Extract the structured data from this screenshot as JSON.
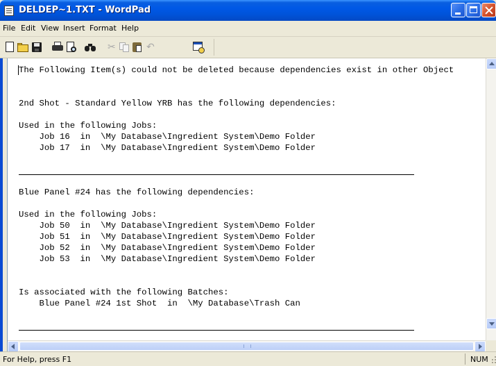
{
  "window": {
    "title": "DELDEP~1.TXT - WordPad",
    "controls": [
      "minimize",
      "maximize",
      "close"
    ]
  },
  "menubar": {
    "items": [
      {
        "label": "File"
      },
      {
        "label": "Edit"
      },
      {
        "label": "View"
      },
      {
        "label": "Insert"
      },
      {
        "label": "Format"
      },
      {
        "label": "Help"
      }
    ]
  },
  "toolbar": {
    "buttons": [
      {
        "name": "new",
        "icon": "new-document-icon",
        "enabled": true
      },
      {
        "name": "open",
        "icon": "open-folder-icon",
        "enabled": true
      },
      {
        "name": "save",
        "icon": "save-disk-icon",
        "enabled": true
      },
      {
        "name": "print",
        "icon": "printer-icon",
        "enabled": true
      },
      {
        "name": "print-preview",
        "icon": "print-preview-icon",
        "enabled": true
      },
      {
        "name": "find",
        "icon": "binoculars-icon",
        "enabled": true
      },
      {
        "name": "cut",
        "icon": "scissors-icon",
        "enabled": false
      },
      {
        "name": "copy",
        "icon": "copy-icon",
        "enabled": false
      },
      {
        "name": "paste",
        "icon": "paste-icon",
        "enabled": true
      },
      {
        "name": "undo",
        "icon": "undo-icon",
        "enabled": false
      },
      {
        "name": "date-time",
        "icon": "date-time-icon",
        "enabled": true
      }
    ]
  },
  "document": {
    "lines": [
      "The Following Item(s) could not be deleted because dependencies exist in other Object",
      "2nd Shot - Standard Yellow YRB has the following dependencies:",
      "Used in the following Jobs:",
      "    Job 16  in  \\My Database\\Ingredient System\\Demo Folder",
      "    Job 17  in  \\My Database\\Ingredient System\\Demo Folder",
      "Blue Panel #24 has the following dependencies:",
      "Used in the following Jobs:",
      "    Job 50  in  \\My Database\\Ingredient System\\Demo Folder",
      "    Job 51  in  \\My Database\\Ingredient System\\Demo Folder",
      "    Job 52  in  \\My Database\\Ingredient System\\Demo Folder",
      "    Job 53  in  \\My Database\\Ingredient System\\Demo Folder",
      "Is associated with the following Batches:",
      "    Blue Panel #24 1st Shot  in  \\My Database\\Trash Can"
    ]
  },
  "statusbar": {
    "help_text": "For Help, press F1",
    "num_indicator": "NUM"
  },
  "colors": {
    "titlebar": "#0053d9",
    "chrome": "#ece9d8",
    "close_button": "#d5532d"
  }
}
